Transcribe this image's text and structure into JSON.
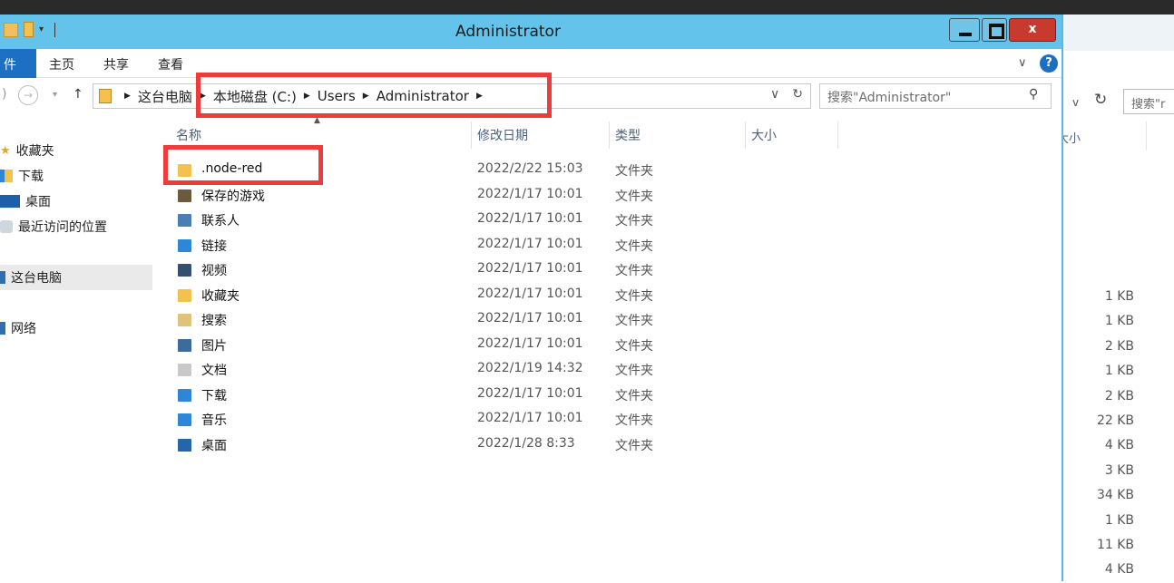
{
  "window": {
    "title": "Administrator",
    "close_label": "x"
  },
  "ribbon": {
    "tabs": [
      "件",
      "主页",
      "共享",
      "查看"
    ],
    "help": "?"
  },
  "address": {
    "crumbs": [
      "这台电脑",
      "本地磁盘 (C:)",
      "Users",
      "Administrator"
    ]
  },
  "search": {
    "placeholder": "搜索\"Administrator\""
  },
  "sidebar": {
    "items": [
      {
        "label": "收藏夹",
        "icon": "star-icon"
      },
      {
        "label": "下载",
        "icon": "download-folder-icon"
      },
      {
        "label": "桌面",
        "icon": "desktop-icon"
      },
      {
        "label": "最近访问的位置",
        "icon": "recent-places-icon"
      },
      {
        "label": "这台电脑",
        "icon": "computer-icon"
      },
      {
        "label": "网络",
        "icon": "network-icon"
      }
    ]
  },
  "columns": {
    "name": "名称",
    "date": "修改日期",
    "type": "类型",
    "size": "大小"
  },
  "files": [
    {
      "name": ".node-red",
      "date": "2022/2/22 15:03",
      "type": "文件夹",
      "color": "#f2c14e"
    },
    {
      "name": "保存的游戏",
      "date": "2022/1/17 10:01",
      "type": "文件夹",
      "color": "#6b5a3e"
    },
    {
      "name": "联系人",
      "date": "2022/1/17 10:01",
      "type": "文件夹",
      "color": "#4a7fb5"
    },
    {
      "name": "链接",
      "date": "2022/1/17 10:01",
      "type": "文件夹",
      "color": "#2f86d6"
    },
    {
      "name": "视频",
      "date": "2022/1/17 10:01",
      "type": "文件夹",
      "color": "#35506e"
    },
    {
      "name": "收藏夹",
      "date": "2022/1/17 10:01",
      "type": "文件夹",
      "color": "#f2c14e"
    },
    {
      "name": "搜索",
      "date": "2022/1/17 10:01",
      "type": "文件夹",
      "color": "#e0c27a"
    },
    {
      "name": "图片",
      "date": "2022/1/17 10:01",
      "type": "文件夹",
      "color": "#3c6c9c"
    },
    {
      "name": "文档",
      "date": "2022/1/19 14:32",
      "type": "文件夹",
      "color": "#c9c9c9"
    },
    {
      "name": "下载",
      "date": "2022/1/17 10:01",
      "type": "文件夹",
      "color": "#2f86d6"
    },
    {
      "name": "音乐",
      "date": "2022/1/17 10:01",
      "type": "文件夹",
      "color": "#2f86d6"
    },
    {
      "name": "桌面",
      "date": "2022/1/28 8:33",
      "type": "文件夹",
      "color": "#2466a8"
    }
  ],
  "background_window": {
    "search_text": "搜索\"r",
    "size_header": "大小",
    "sizes": [
      "1 KB",
      "1 KB",
      "2 KB",
      "1 KB",
      "2 KB",
      "22 KB",
      "4 KB",
      "3 KB",
      "34 KB",
      "1 KB",
      "11 KB",
      "4 KB"
    ]
  },
  "annotations": {
    "highlight_color": "#ee3b3b"
  }
}
